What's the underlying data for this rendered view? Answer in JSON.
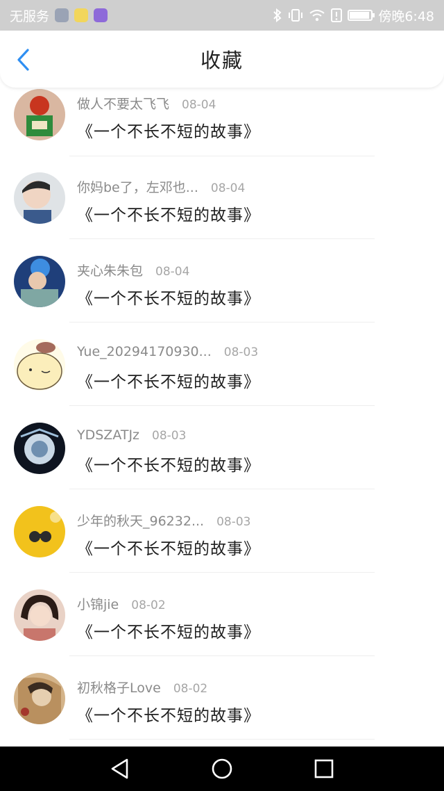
{
  "status_bar": {
    "carrier": "无服务",
    "time": "傍晚6:48"
  },
  "header": {
    "title": "收藏"
  },
  "items": [
    {
      "username": "做人不要太飞飞",
      "date": "08-04",
      "title": "《一个不长不短的故事》"
    },
    {
      "username": "你妈be了，左邓也...",
      "date": "08-04",
      "title": "《一个不长不短的故事》"
    },
    {
      "username": "夹心朱朱包",
      "date": "08-04",
      "title": "《一个不长不短的故事》"
    },
    {
      "username": "Yue_20294170930...",
      "date": "08-03",
      "title": "《一个不长不短的故事》"
    },
    {
      "username": "YDSZATJz",
      "date": "08-03",
      "title": "《一个不长不短的故事》"
    },
    {
      "username": "少年的秋天_96232...",
      "date": "08-03",
      "title": "《一个不长不短的故事》"
    },
    {
      "username": "小锦jie",
      "date": "08-02",
      "title": "《一个不长不短的故事》"
    },
    {
      "username": "初秋格子Love",
      "date": "08-02",
      "title": "《一个不长不短的故事》"
    }
  ],
  "colors": {
    "accent": "#2f8ff2",
    "status_bar_bg": "#cfcfcf",
    "nav_bar_bg": "#000000"
  },
  "icons": {
    "back": "chevron-left-icon",
    "status": [
      "bluetooth-icon",
      "vibrate-icon",
      "wifi-icon",
      "alert-icon",
      "battery-icon"
    ],
    "nav": [
      "back-triangle-icon",
      "home-circle-icon",
      "recents-square-icon"
    ]
  }
}
